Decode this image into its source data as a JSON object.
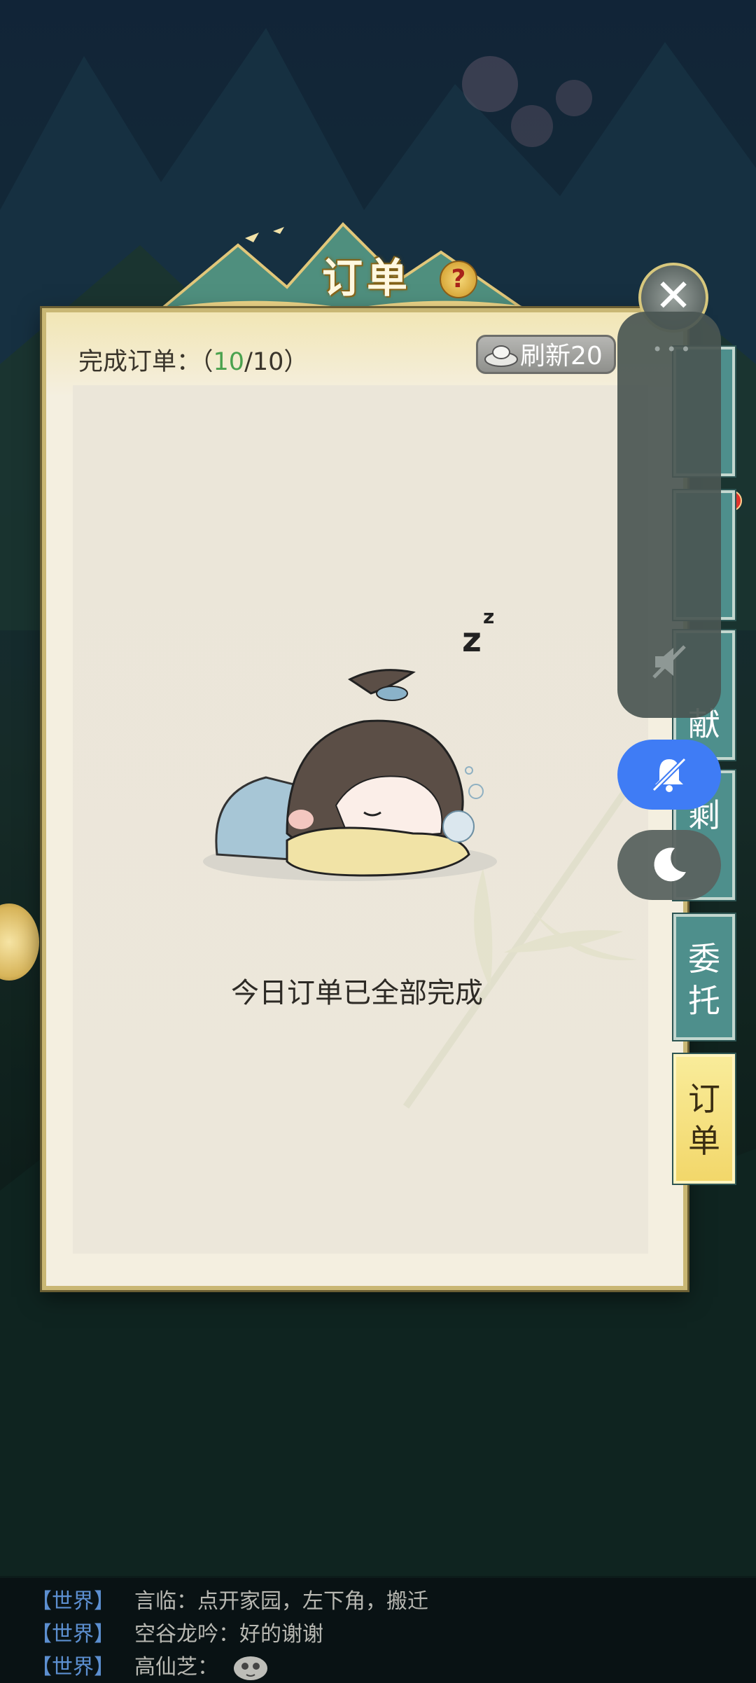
{
  "panel": {
    "title": "订单",
    "help_label": "?",
    "close_label": "✕",
    "progress_label": "完成订单：",
    "progress_open": "（",
    "progress_current": "10",
    "progress_sep": "/",
    "progress_total": "10",
    "progress_close": "）",
    "refresh_label": "刷新20",
    "done_message": "今日订单已全部完成"
  },
  "side_tabs": [
    {
      "label": ""
    },
    {
      "label": ""
    },
    {
      "label": "献"
    },
    {
      "label": "剩"
    },
    {
      "label": "委托"
    },
    {
      "label": "订单"
    }
  ],
  "system_overlay": {
    "dots": "•••"
  },
  "chat": [
    {
      "channel": "【世界】",
      "text": "言临：点开家园，左下角，搬迁"
    },
    {
      "channel": "【世界】",
      "text": "空谷龙吟：好的谢谢"
    },
    {
      "channel": "【世界】",
      "text": "高仙芝："
    }
  ],
  "colors": {
    "progress_current": "#4aa24e",
    "active_tab": "#f2d76a",
    "tab": "#4e8f8c",
    "bell_button": "#3f7cf5"
  },
  "icons": [
    "help-icon",
    "close-icon",
    "ingot-icon",
    "mute-icon",
    "bell-off-icon",
    "moon-icon",
    "chat-icon"
  ]
}
